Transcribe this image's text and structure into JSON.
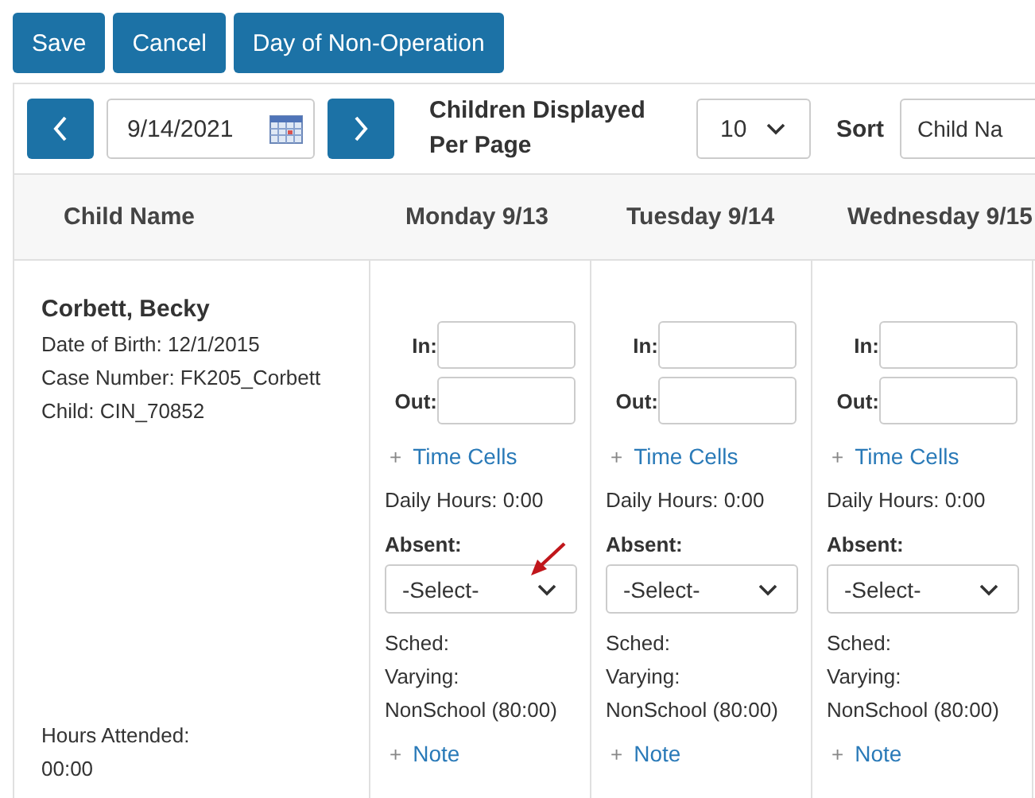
{
  "toolbar_buttons": [
    "Save",
    "Cancel",
    "Day of Non-Operation"
  ],
  "filter_bar": {
    "date": "9/14/2021",
    "per_page_label": "Children Displayed Per Page",
    "per_page_value": "10",
    "sort_label": "Sort",
    "sort_value": "Child Na"
  },
  "table": {
    "columns": [
      "Child Name",
      "Monday 9/13",
      "Tuesday 9/14",
      "Wednesday 9/15"
    ],
    "child": {
      "name": "Corbett, Becky",
      "details": [
        "Date of Birth: 12/1/2015",
        "Case Number: FK205_Corbett",
        "Child: CIN_70852"
      ],
      "hours_label": "Hours Attended:",
      "hours_value": "00:00"
    },
    "days": [
      {
        "in_label": "In:",
        "out_label": "Out:",
        "plus": "+",
        "time_cells": "Time Cells",
        "daily_hours": "Daily Hours: 0:00",
        "absent_label": "Absent:",
        "absent_value": "-Select-",
        "sched": [
          "Sched:",
          "Varying:",
          "NonSchool (80:00)"
        ],
        "note": "Note",
        "arrow": true
      },
      {
        "in_label": "In:",
        "out_label": "Out:",
        "plus": "+",
        "time_cells": "Time Cells",
        "daily_hours": "Daily Hours: 0:00",
        "absent_label": "Absent:",
        "absent_value": "-Select-",
        "sched": [
          "Sched:",
          "Varying:",
          "NonSchool (80:00)"
        ],
        "note": "Note",
        "arrow": false
      },
      {
        "in_label": "In:",
        "out_label": "Out:",
        "plus": "+",
        "time_cells": "Time Cells",
        "daily_hours": "Daily Hours: 0:00",
        "absent_label": "Absent:",
        "absent_value": "-Select-",
        "sched": [
          "Sched:",
          "Varying:",
          "NonSchool (80:00)"
        ],
        "note": "Note",
        "arrow": false
      }
    ]
  }
}
